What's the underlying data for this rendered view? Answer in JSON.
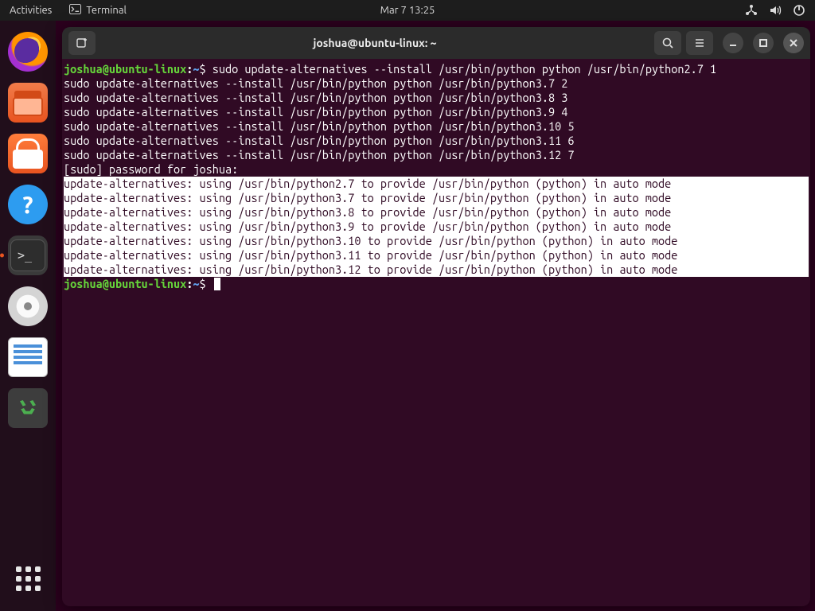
{
  "topbar": {
    "activities": "Activities",
    "app_label": "Terminal",
    "clock": "Mar 7  13:25"
  },
  "window": {
    "title": "joshua@ubuntu-linux: ~"
  },
  "prompt": {
    "userhost": "joshua@ubuntu-linux",
    "path": "~",
    "symbol": "$"
  },
  "lines": {
    "cmd1_rest": " sudo update-alternatives --install /usr/bin/python python /usr/bin/python2.7 1",
    "l2": "sudo update-alternatives --install /usr/bin/python python /usr/bin/python3.7 2",
    "l3": "sudo update-alternatives --install /usr/bin/python python /usr/bin/python3.8 3",
    "l4": "sudo update-alternatives --install /usr/bin/python python /usr/bin/python3.9 4",
    "l5": "sudo update-alternatives --install /usr/bin/python python /usr/bin/python3.10 5",
    "l6": "sudo update-alternatives --install /usr/bin/python python /usr/bin/python3.11 6",
    "l7": "sudo update-alternatives --install /usr/bin/python python /usr/bin/python3.12 7",
    "l8": "[sudo] password for joshua: ",
    "s1": "update-alternatives: using /usr/bin/python2.7 to provide /usr/bin/python (python) in auto mode",
    "s2": "update-alternatives: using /usr/bin/python3.7 to provide /usr/bin/python (python) in auto mode",
    "s3": "update-alternatives: using /usr/bin/python3.8 to provide /usr/bin/python (python) in auto mode",
    "s4": "update-alternatives: using /usr/bin/python3.9 to provide /usr/bin/python (python) in auto mode",
    "s5": "update-alternatives: using /usr/bin/python3.10 to provide /usr/bin/python (python) in auto mode",
    "s6": "update-alternatives: using /usr/bin/python3.11 to provide /usr/bin/python (python) in auto mode",
    "s7": "update-alternatives: using /usr/bin/python3.12 to provide /usr/bin/python (python) in auto mode"
  },
  "icons": {
    "help_glyph": "?"
  }
}
